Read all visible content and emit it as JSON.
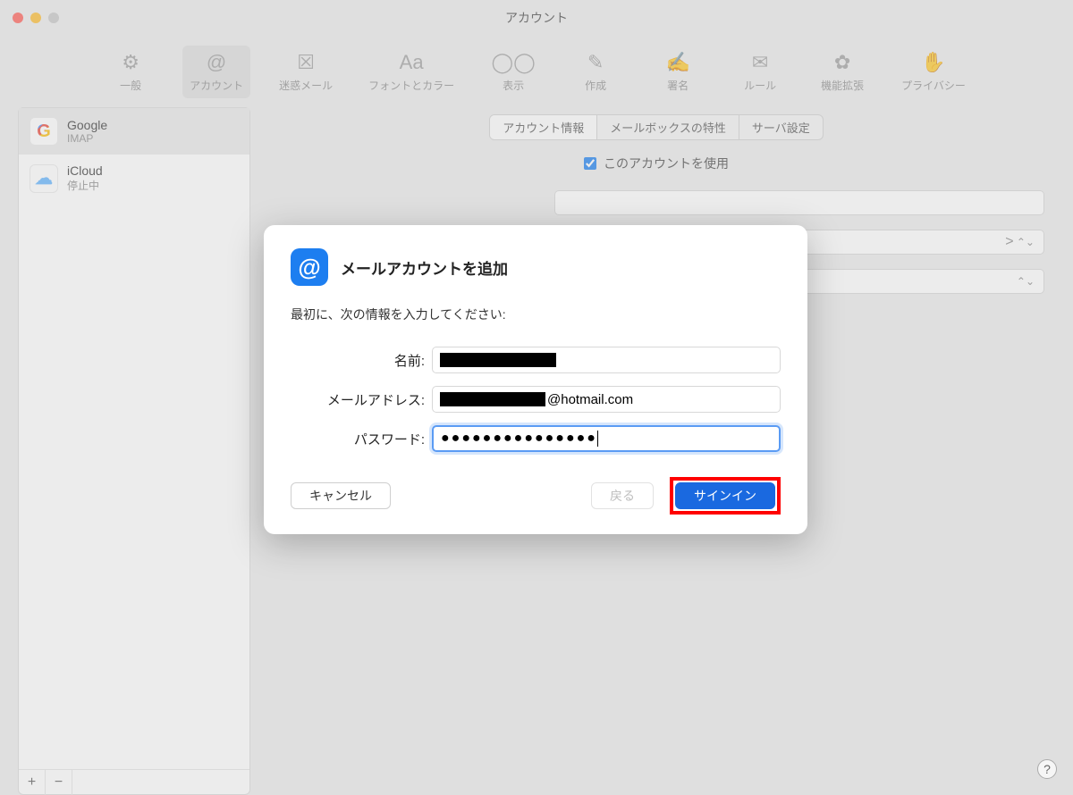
{
  "window": {
    "title": "アカウント"
  },
  "toolbar": [
    {
      "label": "一般",
      "icon": "gear-icon"
    },
    {
      "label": "アカウント",
      "icon": "at-icon",
      "selected": true
    },
    {
      "label": "迷惑メール",
      "icon": "junk-icon"
    },
    {
      "label": "フォントとカラー",
      "icon": "font-icon"
    },
    {
      "label": "表示",
      "icon": "view-icon"
    },
    {
      "label": "作成",
      "icon": "compose-icon"
    },
    {
      "label": "署名",
      "icon": "signature-icon"
    },
    {
      "label": "ルール",
      "icon": "rules-icon"
    },
    {
      "label": "機能拡張",
      "icon": "extensions-icon"
    },
    {
      "label": "プライバシー",
      "icon": "privacy-icon"
    }
  ],
  "sidebar": {
    "accounts": [
      {
        "name": "Google",
        "sub": "IMAP",
        "icon": "G",
        "selected": true
      },
      {
        "name": "iCloud",
        "sub": "停止中",
        "icon": "☁"
      }
    ],
    "add": "+",
    "remove": "−"
  },
  "detail": {
    "segments": [
      "アカウント情報",
      "メールボックスの特性",
      "サーバ設定"
    ],
    "enable_label": "このアカウントを使用",
    "enabled": true,
    "select_arrow": ">"
  },
  "modal": {
    "title": "メールアカウントを追加",
    "instruction": "最初に、次の情報を入力してください:",
    "fields": {
      "name_label": "名前:",
      "email_label": "メールアドレス:",
      "email_suffix": "@hotmail.com",
      "password_label": "パスワード:",
      "password_value": "●●●●●●●●●●●●●●●"
    },
    "buttons": {
      "cancel": "キャンセル",
      "back": "戻る",
      "signin": "サインイン"
    }
  },
  "help": "?"
}
